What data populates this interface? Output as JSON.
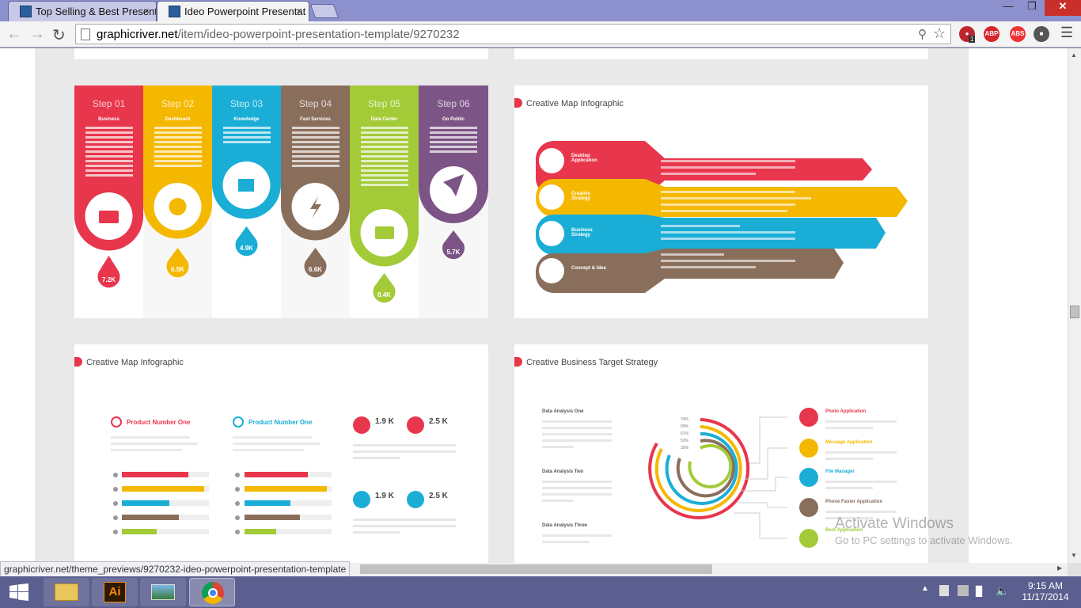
{
  "browser": {
    "tabs": [
      {
        "title": "Top Selling & Best Present"
      },
      {
        "title": "Ideo Powerpoint Presentat"
      }
    ],
    "close_symbol": "×",
    "url": "graphicriver.net/item/ideo-powerpoint-presentation-template/9270232",
    "url_domain": "graphicriver.net",
    "url_path": "/item/ideo-powerpoint-presentation-template/9270232",
    "status_link": "graphicriver.net/theme_previews/9270232-ideo-powerpoint-presentation-template",
    "extensions": [
      "ABP",
      "ABS"
    ],
    "badge_count": "1"
  },
  "slides": {
    "steps": [
      {
        "label": "Step 01",
        "title": "Business",
        "value": "7.2K",
        "color": "#e8364c"
      },
      {
        "label": "Step 02",
        "title": "Dashboard",
        "value": "6.5K",
        "color": "#f5b800"
      },
      {
        "label": "Step 03",
        "title": "Knowledge",
        "value": "4.9K",
        "color": "#1aaed6"
      },
      {
        "label": "Step 04",
        "title": "Fast Services",
        "value": "6.6K",
        "color": "#8a6e5c"
      },
      {
        "label": "Step 05",
        "title": "Data Center",
        "value": "8.4K",
        "color": "#a3cb38"
      },
      {
        "label": "Step 06",
        "title": "Go Public",
        "value": "5.7K",
        "color": "#7d5486"
      }
    ],
    "map1": {
      "title": "Creative Map Infographic",
      "arrows": [
        {
          "label": "Desktop Application",
          "color": "#e8364c"
        },
        {
          "label": "Creative Strategy",
          "color": "#f5b800"
        },
        {
          "label": "Business Strategy",
          "color": "#1aaed6"
        },
        {
          "label": "Concept & Idea",
          "color": "#8a6e5c"
        }
      ]
    },
    "map2": {
      "title": "Creative Map Infographic",
      "product_a": "Product Number One",
      "product_b": "Product Number One",
      "stats": [
        "1.9 K",
        "2.5 K",
        "1.9 K",
        "2.5 K"
      ]
    },
    "target": {
      "title": "Creative Business Target Strategy",
      "analysis": [
        "Data Analysis One",
        "Data Analysis Two",
        "Data Analysis Three"
      ],
      "percents": [
        "74%",
        "69%",
        "61%",
        "53%",
        "32%"
      ],
      "apps": [
        {
          "label": "Photo Application",
          "color": "#e8364c"
        },
        {
          "label": "Message Application",
          "color": "#f5b800"
        },
        {
          "label": "File Manager",
          "color": "#1aaed6"
        },
        {
          "label": "Phone Faster Application",
          "color": "#8a6e5c"
        },
        {
          "label": "Best Application",
          "color": "#a3cb38"
        }
      ]
    }
  },
  "watermark": {
    "title": "Activate Windows",
    "subtitle": "Go to PC settings to activate Windows."
  },
  "taskbar": {
    "time": "9:15 AM",
    "date": "11/17/2014",
    "ai_label": "Ai"
  }
}
